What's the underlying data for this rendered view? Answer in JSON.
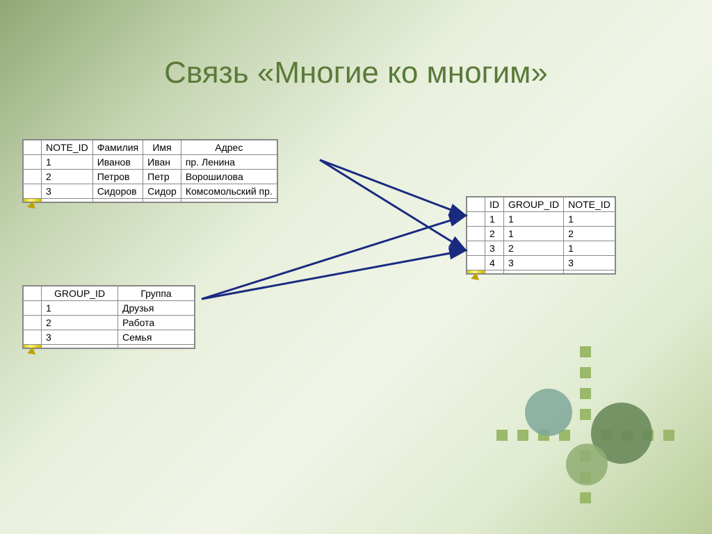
{
  "title": "Связь «Многие ко многим»",
  "table1": {
    "headers": [
      "NOTE_ID",
      "Фамилия",
      "Имя",
      "Адрес"
    ],
    "rows": [
      [
        "1",
        "Иванов",
        "Иван",
        "пр. Ленина"
      ],
      [
        "2",
        "Петров",
        "Петр",
        "Ворошилова"
      ],
      [
        "3",
        "Сидоров",
        "Сидор",
        "Комсомольский пр."
      ]
    ]
  },
  "table2": {
    "headers": [
      "GROUP_ID",
      "Группа"
    ],
    "rows": [
      [
        "1",
        "Друзья"
      ],
      [
        "2",
        "Работа"
      ],
      [
        "3",
        "Семья"
      ]
    ]
  },
  "table3": {
    "headers": [
      "ID",
      "GROUP_ID",
      "NOTE_ID"
    ],
    "rows": [
      [
        "1",
        "1",
        "1"
      ],
      [
        "2",
        "1",
        "2"
      ],
      [
        "3",
        "2",
        "1"
      ],
      [
        "4",
        "3",
        "3"
      ]
    ]
  }
}
